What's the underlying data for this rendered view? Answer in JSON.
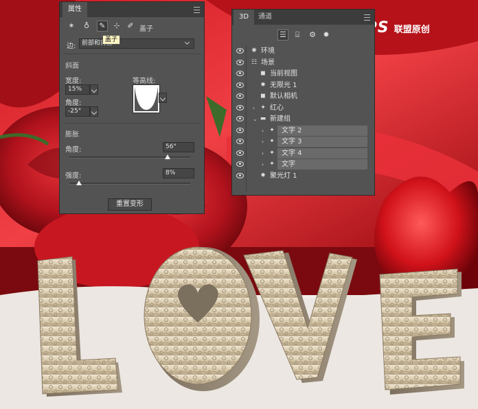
{
  "watermark": {
    "logo_text": "68PS",
    "site_text": "联盟原创"
  },
  "props_panel": {
    "tabs": [
      "属性"
    ],
    "tooltip": "盖子",
    "cap_label": "盖子",
    "edge_label": "边:",
    "edge_value": "前部和背面",
    "bevel_title": "斜面",
    "width_label": "宽度:",
    "width_value": "15%",
    "angle_label": "角度:",
    "angle_value": "-25°",
    "contour_label": "等高线:",
    "inflate_title": "膨胀",
    "inflate_angle_label": "角度:",
    "inflate_angle_value": "56°",
    "inflate_angle_fraction": 0.81,
    "strength_label": "强度:",
    "strength_value": "8%",
    "strength_fraction": 0.08,
    "reset_button": "重置变形"
  },
  "layers_panel": {
    "tabs": [
      "3D",
      "通道"
    ],
    "rows": [
      {
        "name": "环境",
        "icon": "sun-icon",
        "indent": 0,
        "hl": false
      },
      {
        "name": "场景",
        "icon": "scene-icon",
        "indent": 0,
        "hl": false
      },
      {
        "name": "当前视图",
        "icon": "camera-icon",
        "indent": 1,
        "hl": false
      },
      {
        "name": "无限光 1",
        "icon": "light-icon",
        "indent": 1,
        "hl": false
      },
      {
        "name": "默认相机",
        "icon": "camera-icon",
        "indent": 1,
        "hl": false
      },
      {
        "name": "红心",
        "icon": "mesh-icon",
        "indent": 1,
        "hl": false,
        "arrow": "›"
      },
      {
        "name": "新建组",
        "icon": "folder-icon",
        "indent": 1,
        "hl": false,
        "arrow": "⌄"
      },
      {
        "name": "文字 2",
        "icon": "mesh-icon",
        "indent": 2,
        "hl": true,
        "arrow": "›"
      },
      {
        "name": "文字 3",
        "icon": "mesh-icon",
        "indent": 2,
        "hl": true,
        "arrow": "›"
      },
      {
        "name": "文字 4",
        "icon": "mesh-icon",
        "indent": 2,
        "hl": true,
        "arrow": "›"
      },
      {
        "name": "文字",
        "icon": "mesh-icon",
        "indent": 2,
        "hl": true,
        "arrow": "›"
      },
      {
        "name": "聚光灯 1",
        "icon": "spotlight-icon",
        "indent": 1,
        "hl": false
      }
    ]
  },
  "artwork": {
    "letters": [
      "L",
      "O",
      "V",
      "E"
    ]
  }
}
